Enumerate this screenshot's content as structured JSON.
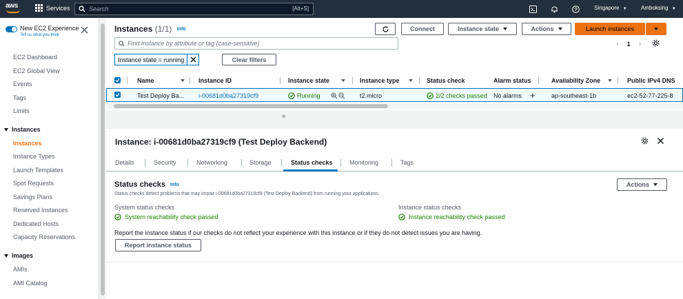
{
  "topnav": {
    "logo_text": "aws",
    "services_label": "Services",
    "search_placeholder": "Search",
    "search_shortcut": "[Alt+S]",
    "region": "Singapore",
    "account": "Amboksing"
  },
  "sidebar": {
    "toggle_title": "New EC2 Experience",
    "toggle_subtitle": "Tell us what you think",
    "items_top": [
      "EC2 Dashboard",
      "EC2 Global View",
      "Events",
      "Tags",
      "Limits"
    ],
    "section_instances": "Instances",
    "instances_items": [
      "Instances",
      "Instance Types",
      "Launch Templates",
      "Spot Requests",
      "Savings Plans",
      "Reserved Instances",
      "Dedicated Hosts",
      "Capacity Reservations"
    ],
    "section_images": "Images",
    "images_items": [
      "AMIs",
      "AMI Catalog"
    ]
  },
  "instances_panel": {
    "title": "Instances",
    "count": "(1/1)",
    "info": "Info",
    "connect": "Connect",
    "instance_state": "Instance state",
    "actions": "Actions",
    "launch": "Launch instances",
    "find_placeholder": "Find instance by attribute or tag (case-sensitive)",
    "page": "1",
    "filter_chip": "Instance state = running",
    "clear_filters": "Clear filters",
    "columns": [
      "Name",
      "Instance ID",
      "Instance state",
      "Instance type",
      "Status check",
      "Alarm status",
      "Availability Zone",
      "Public IPv4 DNS"
    ],
    "row": {
      "name": "Test Deploy Ba...",
      "id": "i-00681d0ba27319cf9",
      "state": "Running",
      "type": "t2.micro",
      "status": "2/2 checks passed",
      "alarm": "No alarms",
      "az": "ap-southeast-1b",
      "dns": "ec2-52-77-225-8"
    }
  },
  "details": {
    "drag_handle": "=",
    "title": "Instance: i-00681d0ba27319cf9 (Test Deploy Backend)",
    "tabs": [
      "Details",
      "Security",
      "Networking",
      "Storage",
      "Status checks",
      "Monitoring",
      "Tags"
    ],
    "active_tab": "Status checks",
    "section_title": "Status checks",
    "info": "Info",
    "description": "Status checks detect problems that may impair i-00681d0ba27319cf9 (Test Deploy Backend) from running your applications.",
    "actions": "Actions",
    "system_label": "System status checks",
    "system_value": "System reachability check passed",
    "instance_label": "Instance status checks",
    "instance_value": "Instance reachability check passed",
    "report_text": "Report the instance status if our checks do not reflect your experience with this instance or if they do not detect issues you are having.",
    "report_button": "Report instance status"
  }
}
